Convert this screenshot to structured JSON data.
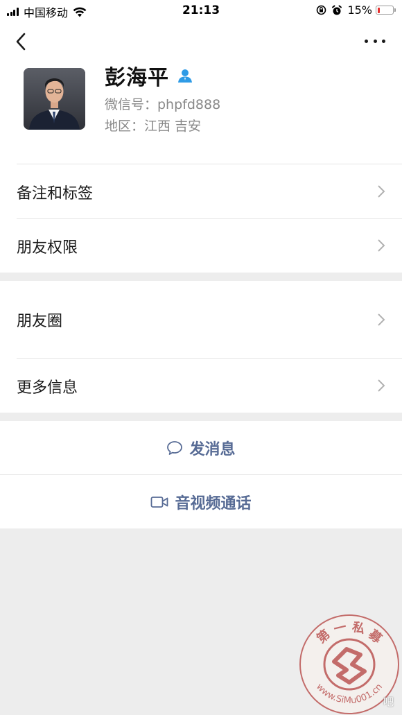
{
  "status_bar": {
    "carrier": "中国移动",
    "time": "21:13",
    "battery_percent": "15%",
    "battery_level": 0.15,
    "icons": [
      "signal-icon",
      "wifi-icon",
      "orientation-lock-icon",
      "alarm-icon",
      "battery-icon"
    ]
  },
  "nav": {
    "back_icon": "chevron-left-icon",
    "more_icon": "more-dots-icon"
  },
  "profile": {
    "name": "彭海平",
    "wechat_id": "微信号：phpfd888",
    "region": "地区：江西 吉安",
    "badge_icon": "contact-person-icon"
  },
  "menu": {
    "items": [
      {
        "label": "备注和标签"
      },
      {
        "label": "朋友权限"
      },
      {
        "label": "朋友圈"
      },
      {
        "label": "更多信息"
      }
    ]
  },
  "actions": {
    "message_label": "发消息",
    "call_label": "音视频通话"
  },
  "watermark": {
    "top_text": "第 一 私 募",
    "url_text": "www.SiMu001.cn",
    "corner_text": "吧"
  },
  "colors": {
    "link_blue": "#576b95",
    "badge_blue": "#2e9be6",
    "background": "#ededed",
    "seal_red": "#b5413f"
  }
}
